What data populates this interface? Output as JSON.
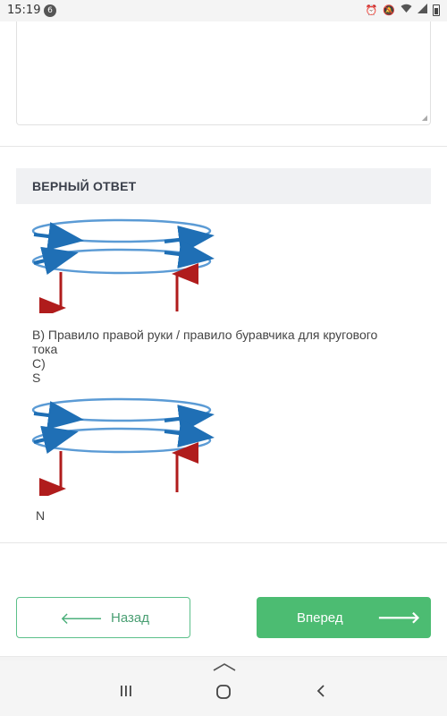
{
  "status_bar": {
    "time": "15:19",
    "notification_count": "6",
    "icons": [
      "alarm-icon",
      "mute-icon",
      "wifi-icon",
      "signal-icon",
      "battery-icon"
    ]
  },
  "answer": {
    "header": "ВЕРНЫЙ ОТВЕТ",
    "line_b": "B) Правило правой руки / правило буравчика для кругового",
    "line_b_cont": "тока",
    "line_c": "C)",
    "line_s": "S",
    "label_n": "N",
    "diagram": {
      "coil_color": "#5b9bd5",
      "arrow_color": "#1f6fb5",
      "field_arrow_color": "#b01c1c"
    }
  },
  "navigation": {
    "back_label": "Назад",
    "next_label": "Вперед",
    "accent_color": "#4cbc72"
  },
  "system_nav": {
    "icons": [
      "recent-apps-icon",
      "home-icon",
      "back-icon"
    ]
  }
}
